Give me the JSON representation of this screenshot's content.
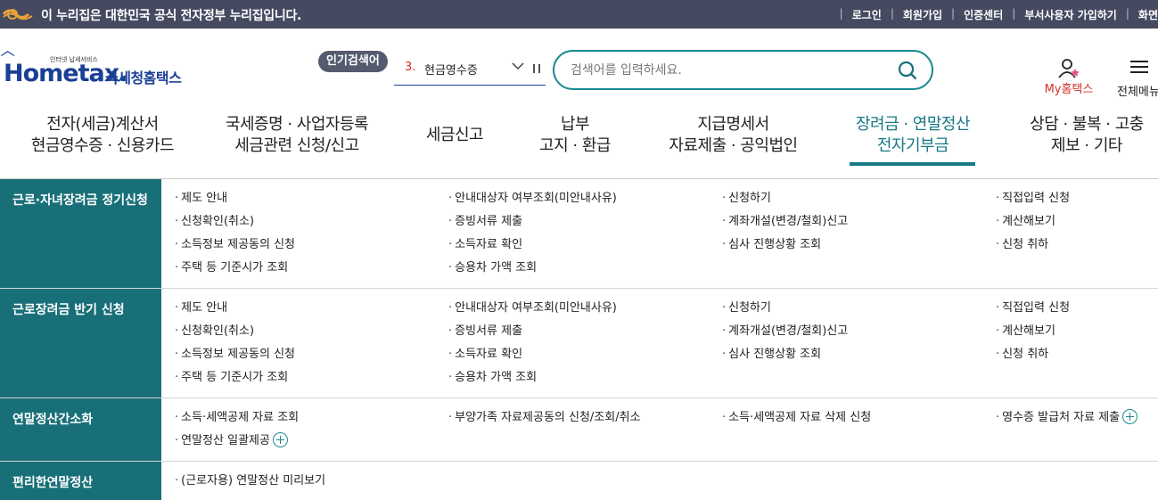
{
  "gov_bar": {
    "text": "이 누리집은 대한민국 공식 전자정부 누리집입니다.",
    "links": [
      "로그인",
      "회원가입",
      "인증센터",
      "부서사용자 가입하기",
      "화면"
    ]
  },
  "logo": {
    "sub": "인터넷 납세서비스",
    "main": "Hometax.",
    "korean": "국세청홈택스"
  },
  "popular": {
    "badge": "인기검색어",
    "rank": "3.",
    "word": "현금영수증"
  },
  "search": {
    "placeholder": "검색어를 입력하세요."
  },
  "header_actions": {
    "my_home": "My홈택스",
    "all_menu": "전체메뉴"
  },
  "nav": [
    {
      "line1": "전자(세금)계산서",
      "line2": "현금영수증 · 신용카드"
    },
    {
      "line1": "국세증명 · 사업자등록",
      "line2": "세금관련 신청/신고"
    },
    {
      "line1": "세금신고",
      "line2": ""
    },
    {
      "line1": "납부",
      "line2": "고지 · 환급"
    },
    {
      "line1": "지급명세서",
      "line2": "자료제출 · 공익법인"
    },
    {
      "line1": "장려금 · 연말정산",
      "line2": "전자기부금"
    },
    {
      "line1": "상담 · 불복 · 고충",
      "line2": "제보 · 기타"
    }
  ],
  "colors": {
    "accent": "#167985",
    "title_bg": "#196f78",
    "gov_bar": "#454a61",
    "brand": "#1b3f96"
  },
  "sections": [
    {
      "title": "근로·자녀장려금 정기신청",
      "links": [
        "제도 안내",
        "안내대상자 여부조회(미안내사유)",
        "신청하기",
        "직접입력 신청",
        "신청확인(취소)",
        "증빙서류 제출",
        "계좌개설(변경/철회)신고",
        "계산해보기",
        "소득정보 제공동의 신청",
        "소득자료 확인",
        "심사 진행상황 조회",
        "신청 취하",
        "주택 등 기준시가 조회",
        "승용차 가액 조회"
      ]
    },
    {
      "title": "근로장려금 반기 신청",
      "links": [
        "제도 안내",
        "안내대상자 여부조회(미안내사유)",
        "신청하기",
        "직접입력 신청",
        "신청확인(취소)",
        "증빙서류 제출",
        "계좌개설(변경/철회)신고",
        "계산해보기",
        "소득정보 제공동의 신청",
        "소득자료 확인",
        "심사 진행상황 조회",
        "신청 취하",
        "주택 등 기준시가 조회",
        "승용차 가액 조회"
      ]
    },
    {
      "title": "연말정산간소화",
      "links": [
        "소득·세액공제 자료 조회",
        "부양가족 자료제공동의 신청/조회/취소",
        "소득·세액공제 자료 삭제 신청",
        "영수증 발급처 자료 제출",
        "연말정산 일괄제공"
      ],
      "expandable": [
        "영수증 발급처 자료 제출",
        "연말정산 일괄제공"
      ]
    },
    {
      "title": "편리한연말정산",
      "links": [
        "(근로자용) 연말정산 미리보기"
      ]
    }
  ]
}
